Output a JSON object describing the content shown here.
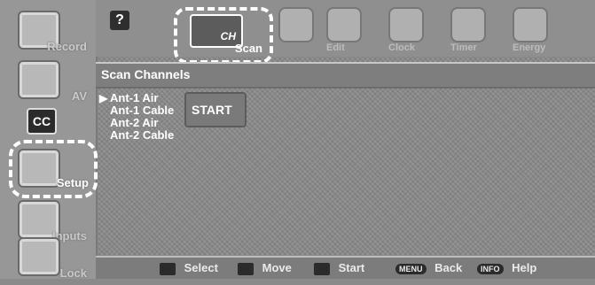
{
  "sidebar": {
    "items": [
      {
        "label": "Record"
      },
      {
        "label": "AV"
      },
      {
        "label": "CC"
      },
      {
        "label": "Setup"
      },
      {
        "label": "Inputs"
      },
      {
        "label": "Lock"
      }
    ],
    "active": "Setup"
  },
  "topmenu": {
    "help_icon_text": "?",
    "items": [
      {
        "label": "Scan"
      },
      {
        "label": "Edit"
      },
      {
        "label": "Clock"
      },
      {
        "label": "Timer"
      },
      {
        "label": "Energy"
      }
    ],
    "selected": "Scan",
    "scan_ch_text": "CH"
  },
  "section": {
    "title": "Scan Channels"
  },
  "options": [
    {
      "label": "Ant-1 Air",
      "selected": true
    },
    {
      "label": "Ant-1 Cable"
    },
    {
      "label": "Ant-2 Air"
    },
    {
      "label": "Ant-2 Cable"
    }
  ],
  "buttons": {
    "start": "START"
  },
  "bottom": {
    "select": "Select",
    "move": "Move",
    "start": "Start",
    "menu_pill": "MENU",
    "back": "Back",
    "info_pill": "INFO",
    "help": "Help"
  }
}
